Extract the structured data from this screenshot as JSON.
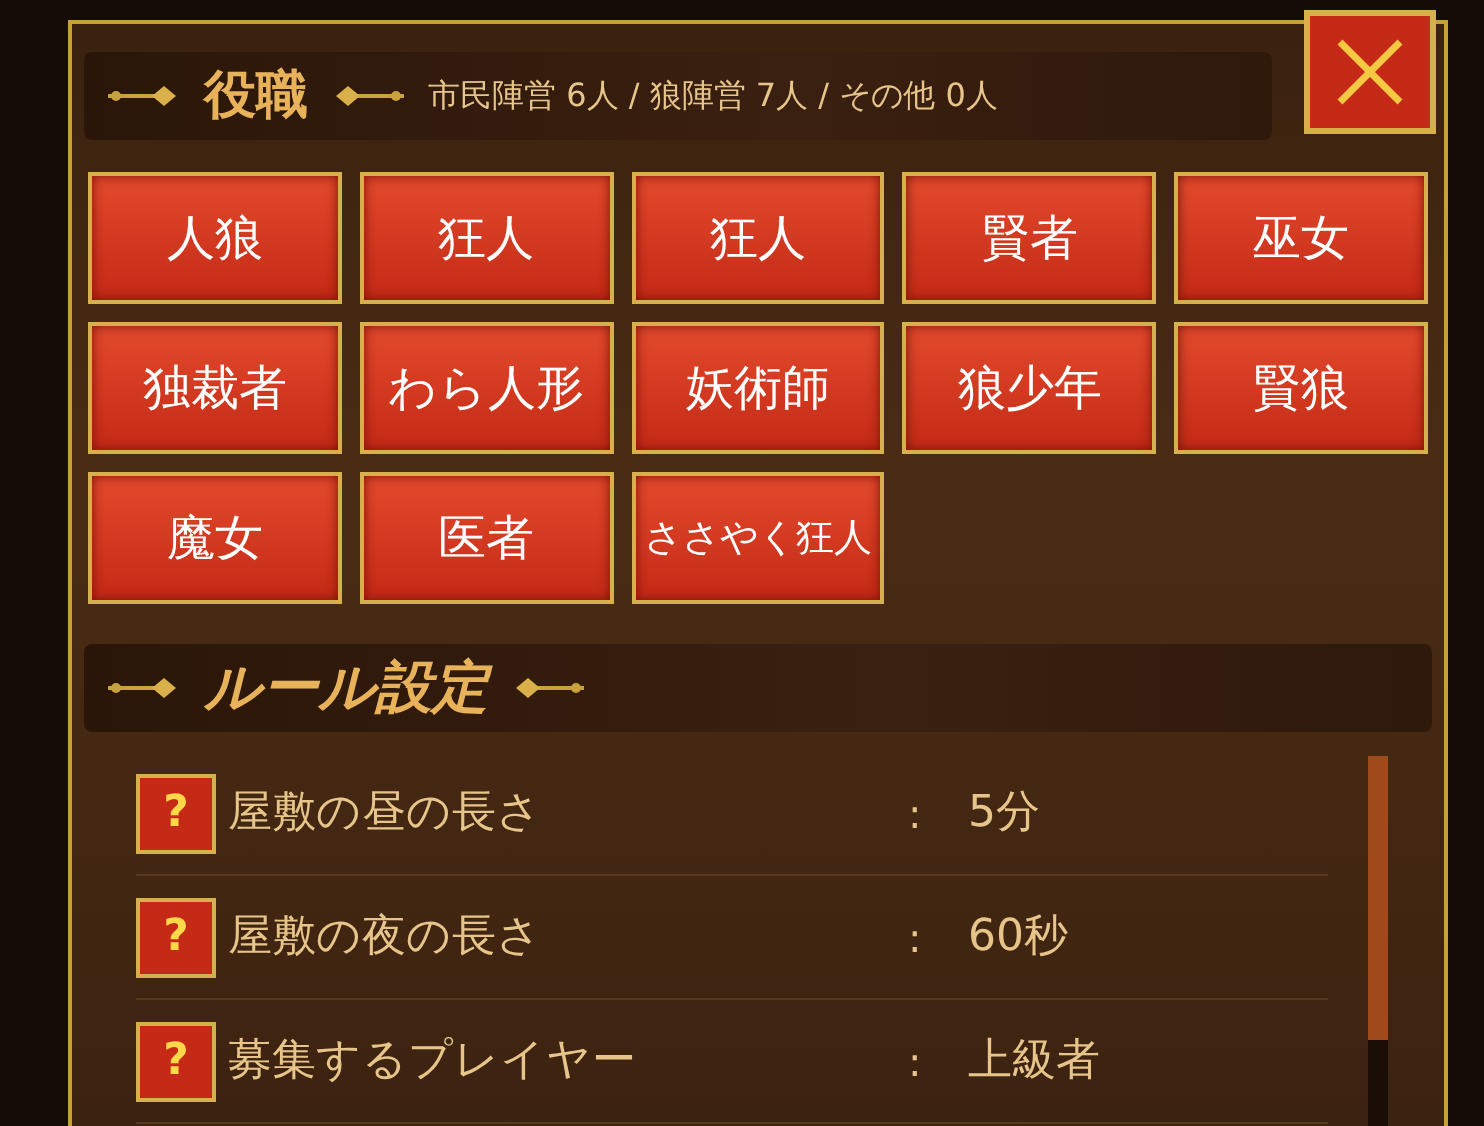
{
  "roles_section": {
    "title": "役職",
    "summary": "市民陣営 6人 / 狼陣営 7人 / その他 0人"
  },
  "roles": [
    "人狼",
    "狂人",
    "狂人",
    "賢者",
    "巫女",
    "独裁者",
    "わら人形",
    "妖術師",
    "狼少年",
    "賢狼",
    "魔女",
    "医者",
    "ささやく狂人"
  ],
  "rules_section": {
    "title": "ルール設定"
  },
  "rules": [
    {
      "help": "?",
      "label": "屋敷の昼の長さ",
      "separator": ":",
      "value": "5分"
    },
    {
      "help": "?",
      "label": "屋敷の夜の長さ",
      "separator": ":",
      "value": "60秒"
    },
    {
      "help": "?",
      "label": "募集するプレイヤー",
      "separator": ":",
      "value": "上級者"
    }
  ]
}
